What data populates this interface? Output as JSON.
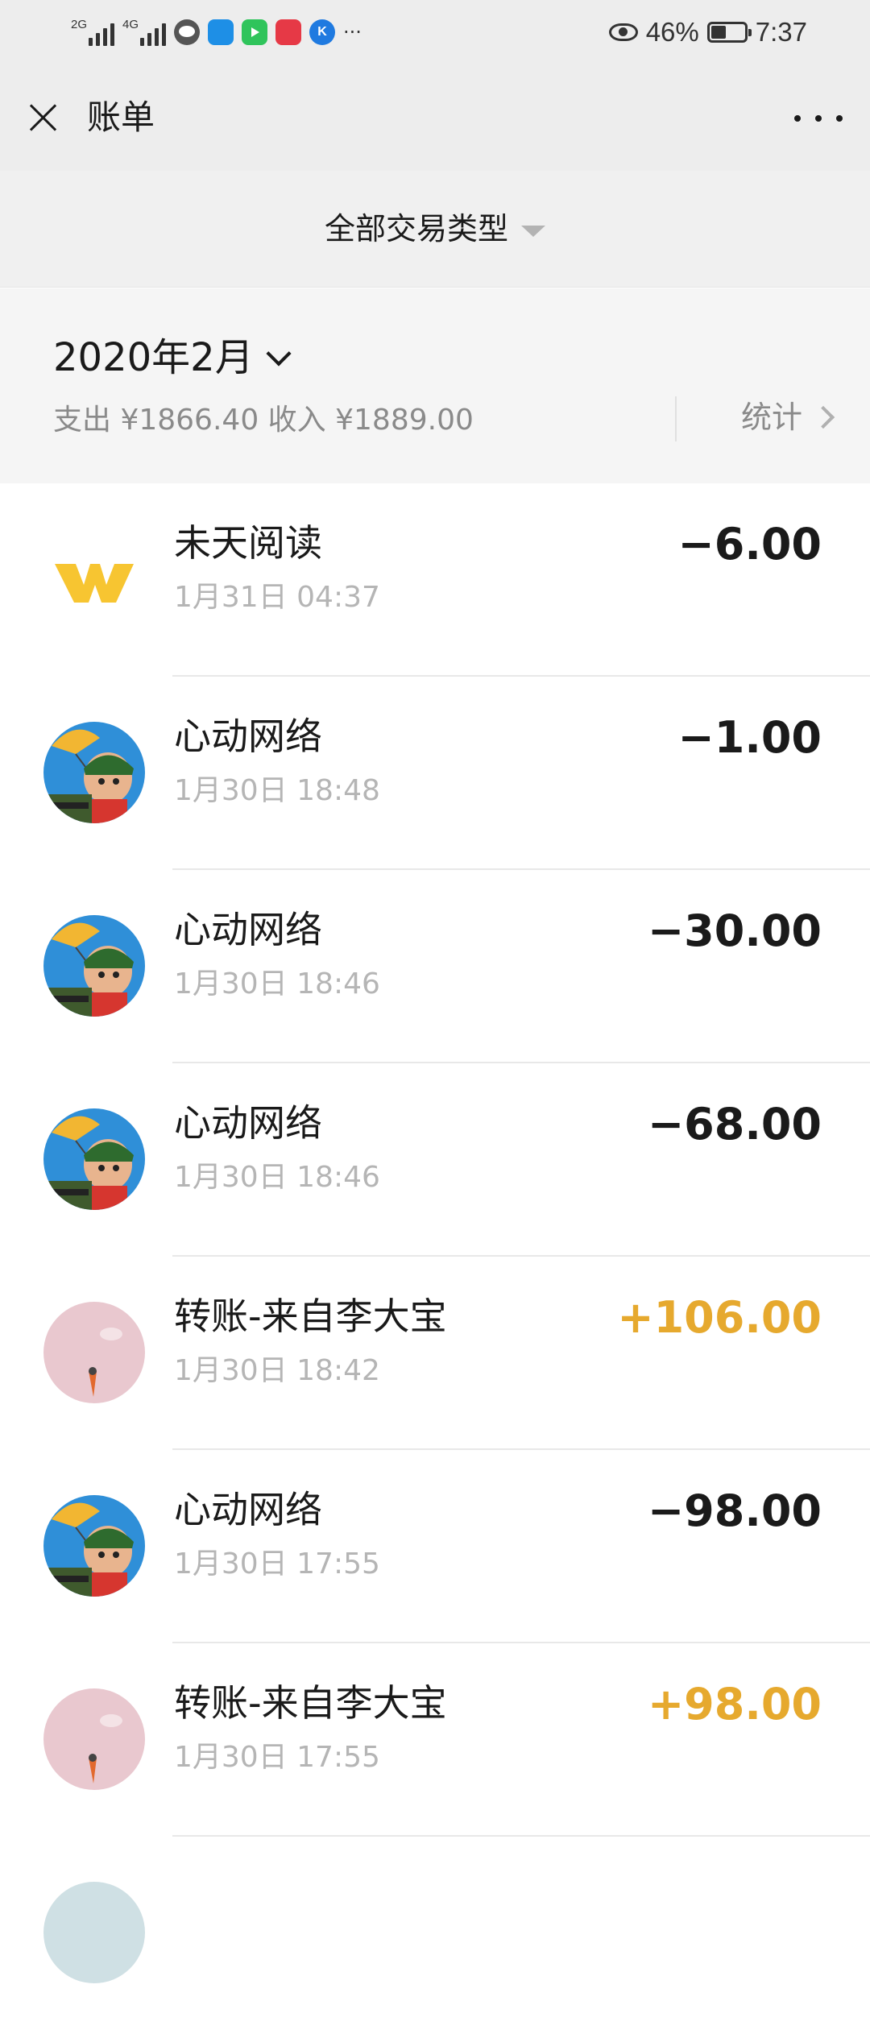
{
  "status_bar": {
    "network_1": "2G",
    "network_2": "4G",
    "more": "···",
    "battery_percent": "46%",
    "battery_level": 0.46,
    "time": "7:37"
  },
  "nav": {
    "title": "账单"
  },
  "filter": {
    "label": "全部交易类型"
  },
  "month": {
    "title": "2020年2月",
    "summary": "支出 ¥1866.40 收入 ¥1889.00",
    "stats_label": "统计"
  },
  "transactions": [
    {
      "name": "未天阅读",
      "time": "1月31日 04:37",
      "amount": "−6.00",
      "type": "expense",
      "avatar": "logo-w"
    },
    {
      "name": "心动网络",
      "time": "1月30日 18:48",
      "amount": "−1.00",
      "type": "expense",
      "avatar": "game"
    },
    {
      "name": "心动网络",
      "time": "1月30日 18:46",
      "amount": "−30.00",
      "type": "expense",
      "avatar": "game"
    },
    {
      "name": "心动网络",
      "time": "1月30日 18:46",
      "amount": "−68.00",
      "type": "expense",
      "avatar": "game"
    },
    {
      "name": "转账-来自李大宝",
      "time": "1月30日 18:42",
      "amount": "+106.00",
      "type": "income",
      "avatar": "pink"
    },
    {
      "name": "心动网络",
      "time": "1月30日 17:55",
      "amount": "−98.00",
      "type": "expense",
      "avatar": "game"
    },
    {
      "name": "转账-来自李大宝",
      "time": "1月30日 17:55",
      "amount": "+98.00",
      "type": "income",
      "avatar": "pink"
    }
  ],
  "colors": {
    "income": "#e6a92e",
    "expense": "#1a1a1a",
    "header_bg": "#ededed"
  }
}
